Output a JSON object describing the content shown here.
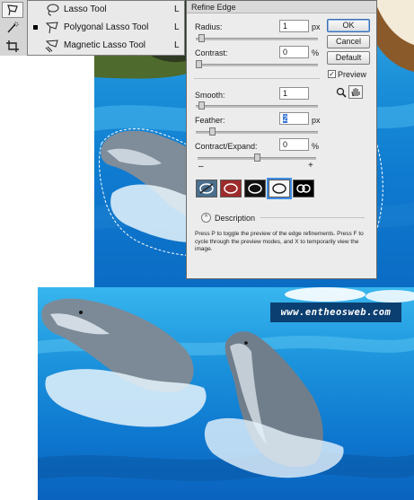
{
  "tools_flyout": {
    "items": [
      {
        "label": "Lasso Tool",
        "shortcut": "L",
        "icon": "lasso-icon",
        "selected": false
      },
      {
        "label": "Polygonal Lasso Tool",
        "shortcut": "L",
        "icon": "polygonal-lasso-icon",
        "selected": true
      },
      {
        "label": "Magnetic Lasso Tool",
        "shortcut": "L",
        "icon": "magnetic-lasso-icon",
        "selected": false
      }
    ]
  },
  "toolbar": {
    "icons": [
      "lasso-icon",
      "quick-selection-icon",
      "crop-icon"
    ]
  },
  "dialog": {
    "title": "Refine Edge",
    "radius": {
      "label": "Radius:",
      "value": "1",
      "unit": "px",
      "slider_fraction": 0.02
    },
    "contrast": {
      "label": "Contrast:",
      "value": "0",
      "unit": "%",
      "slider_fraction": 0.0
    },
    "smooth": {
      "label": "Smooth:",
      "value": "1",
      "slider_fraction": 0.02
    },
    "feather": {
      "label": "Feather:",
      "value": "2",
      "unit": "px",
      "slider_fraction": 0.12
    },
    "contract_expand": {
      "label": "Contract/Expand:",
      "value": "0",
      "unit": "%",
      "minus": "–",
      "plus": "+",
      "slider_fraction": 0.5
    },
    "buttons": {
      "ok": "OK",
      "cancel": "Cancel",
      "default": "Default"
    },
    "preview": {
      "label": "Preview",
      "checked": true
    },
    "preview_modes": [
      "standard",
      "quick-mask",
      "on-black",
      "on-white",
      "mask"
    ],
    "selected_preview_mode": 3,
    "description_label": "Description",
    "help_text": "Press P to toggle the preview of the edge refinements. Press F to cycle through the preview modes, and X to temporarily view the image."
  },
  "watermark": "www.entheosweb.com",
  "colors": {
    "water_light": "#38b6ee",
    "water_dark": "#0a63be",
    "dialog_bg": "#ececec",
    "selection_blue": "#3875d7",
    "watermark_bg": "#0c3f71"
  }
}
